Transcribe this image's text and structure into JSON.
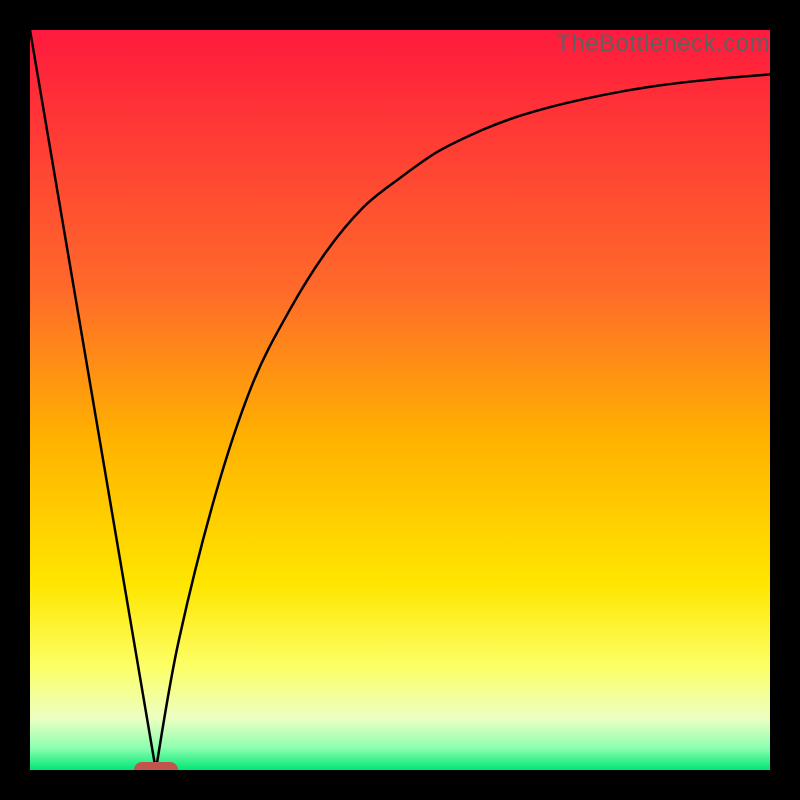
{
  "watermark": "TheBottleneck.com",
  "chart_data": {
    "type": "line",
    "title": "",
    "xlabel": "",
    "ylabel": "",
    "ylim": [
      0,
      100
    ],
    "xlim": [
      0,
      100
    ],
    "gradient_stops": [
      {
        "offset": 0,
        "color": "#ff1a3d"
      },
      {
        "offset": 0.35,
        "color": "#ff6a2a"
      },
      {
        "offset": 0.55,
        "color": "#ffb100"
      },
      {
        "offset": 0.75,
        "color": "#ffe600"
      },
      {
        "offset": 0.86,
        "color": "#fcff66"
      },
      {
        "offset": 0.93,
        "color": "#ecffc2"
      },
      {
        "offset": 0.97,
        "color": "#8dffb0"
      },
      {
        "offset": 1.0,
        "color": "#00e676"
      }
    ],
    "series": [
      {
        "name": "left-segment",
        "x": [
          0,
          17
        ],
        "y": [
          100,
          0
        ]
      },
      {
        "name": "right-curve",
        "x": [
          17,
          20,
          25,
          30,
          35,
          40,
          45,
          50,
          55,
          60,
          65,
          70,
          75,
          80,
          85,
          90,
          95,
          100
        ],
        "y": [
          0,
          17,
          37,
          52,
          62,
          70,
          76,
          80,
          83.5,
          86,
          88,
          89.5,
          90.7,
          91.7,
          92.5,
          93.1,
          93.6,
          94
        ]
      }
    ],
    "marker": {
      "x": 17,
      "y": 0,
      "color": "#c1554b"
    }
  }
}
